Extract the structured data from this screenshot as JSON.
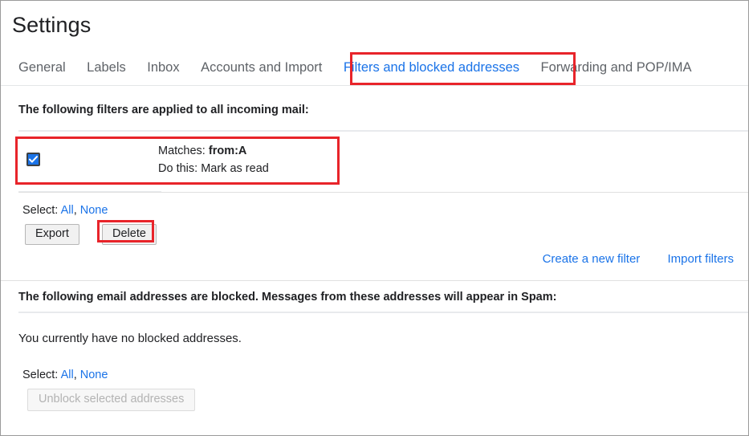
{
  "window": {
    "title": "Settings"
  },
  "tabs": [
    {
      "id": "general",
      "label": "General",
      "active": false
    },
    {
      "id": "labels",
      "label": "Labels",
      "active": false
    },
    {
      "id": "inbox",
      "label": "Inbox",
      "active": false
    },
    {
      "id": "accounts",
      "label": "Accounts and Import",
      "active": false
    },
    {
      "id": "filters",
      "label": "Filters and blocked addresses",
      "active": true
    },
    {
      "id": "forwarding",
      "label": "Forwarding and POP/IMA",
      "active": false
    }
  ],
  "filters_section": {
    "heading": "The following filters are applied to all incoming mail:",
    "rows": [
      {
        "checked": true,
        "matches_label": "Matches:",
        "matches_value": "from:A",
        "action_label": "Do this:",
        "action_value": "Mark as read"
      }
    ],
    "select_label": "Select:",
    "select_all": "All",
    "select_separator": ",",
    "select_none": "None",
    "export_label": "Export",
    "delete_label": "Delete",
    "create_filter_label": "Create a new filter",
    "import_filters_label": "Import filters"
  },
  "blocked_section": {
    "heading": "The following email addresses are blocked. Messages from these addresses will appear in Spam:",
    "empty_message": "You currently have no blocked addresses.",
    "select_label": "Select:",
    "select_all": "All",
    "select_separator": ",",
    "select_none": "None",
    "unblock_label": "Unblock selected addresses"
  },
  "annotations": [
    {
      "id": "redbox-tab",
      "target": "tab-filters-and-blocked-addresses",
      "color": "#e8242a"
    },
    {
      "id": "redbox-filter",
      "target": "filter-row",
      "color": "#e8242a"
    },
    {
      "id": "redbox-delete",
      "target": "delete-button",
      "color": "#e8242a"
    }
  ],
  "colors": {
    "link": "#1a73e8",
    "text": "#202124",
    "muted": "#5f6368",
    "annotation": "#e8242a",
    "divider": "#e8eaed"
  }
}
